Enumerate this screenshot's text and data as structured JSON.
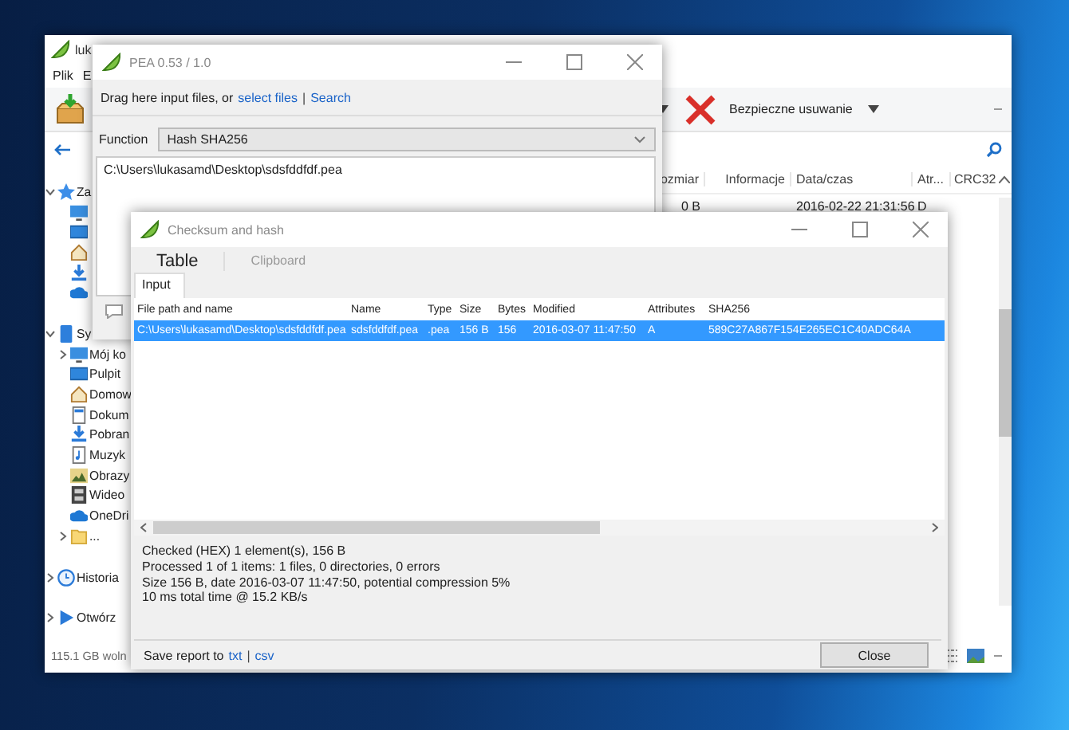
{
  "explorer": {
    "title": "luk",
    "menu": [
      "Plik",
      "E"
    ],
    "toolbar": {
      "action": "Bezpieczne usuwanie"
    },
    "columns": [
      "ozmiar",
      "Informacje",
      "Data/czas",
      "Atr...",
      "CRC32"
    ],
    "rows": [
      {
        "size": "0 B",
        "date": "2016-02-22 21:31:56",
        "attributes": "D"
      }
    ],
    "sidebar": [
      {
        "label": "Za",
        "kind": "star",
        "expanded": true,
        "children": [
          {
            "kind": "monitor"
          },
          {
            "kind": "desktop"
          },
          {
            "kind": "home"
          },
          {
            "kind": "download"
          },
          {
            "kind": "cloud"
          }
        ]
      },
      {
        "label": "Sy",
        "kind": "device",
        "expanded": true,
        "children": [
          {
            "label": "Mój ko",
            "kind": "monitor",
            "expanded": false
          },
          {
            "label": "Pulpit",
            "kind": "desktop"
          },
          {
            "label": "Domow",
            "kind": "home"
          },
          {
            "label": "Dokum",
            "kind": "document"
          },
          {
            "label": "Pobran",
            "kind": "download"
          },
          {
            "label": "Muzyk",
            "kind": "music"
          },
          {
            "label": "Obrazy",
            "kind": "pictures"
          },
          {
            "label": "Wideo",
            "kind": "video"
          },
          {
            "label": "OneDri",
            "kind": "cloud"
          },
          {
            "label": "...",
            "kind": "folder",
            "expanded": false
          }
        ]
      },
      {
        "label": "Historia",
        "kind": "clock",
        "expanded": false
      },
      {
        "label": "Otwórz",
        "kind": "play",
        "expanded": false
      }
    ],
    "status": "115.1 GB woln"
  },
  "pea": {
    "title": "PEA 0.53 / 1.0",
    "drop_text": "Drag here input files, or",
    "links": [
      "select files",
      "Search"
    ],
    "link_separator": "|",
    "function_label": "Function",
    "function_value": "Hash SHA256",
    "input_paths": [
      "C:\\Users\\lukasamd\\Desktop\\sdsfddfdf.pea"
    ]
  },
  "checksum": {
    "title": "Checksum and hash",
    "tabs": [
      {
        "label": "Table",
        "selected": true
      },
      {
        "label": "Clipboard",
        "selected": false
      }
    ],
    "subtabs": [
      {
        "label": "Input",
        "selected": true
      }
    ],
    "table": {
      "columns": [
        "File path and name",
        "Name",
        "Type",
        "Size",
        "Bytes",
        "Modified",
        "Attributes",
        "SHA256"
      ],
      "rows": [
        {
          "selected": true,
          "cells": [
            "C:\\Users\\lukasamd\\Desktop\\sdsfddfdf.pea",
            "sdsfddfdf.pea",
            ".pea",
            "156 B",
            "156",
            "2016-03-07 11:47:50",
            "A",
            "589C27A867F154E265EC1C40ADC64A"
          ]
        }
      ]
    },
    "report": [
      "Checked (HEX) 1 element(s), 156 B",
      "Processed 1 of 1 items: 1 files, 0 directories, 0 errors",
      "Size 156 B, date 2016-03-07 11:47:50, potential compression 5%",
      "10 ms total time @ 15.2 KB/s"
    ],
    "save": {
      "label": "Save report to",
      "links": [
        "txt",
        "csv"
      ],
      "separator": "|"
    },
    "close_button": "Close"
  }
}
